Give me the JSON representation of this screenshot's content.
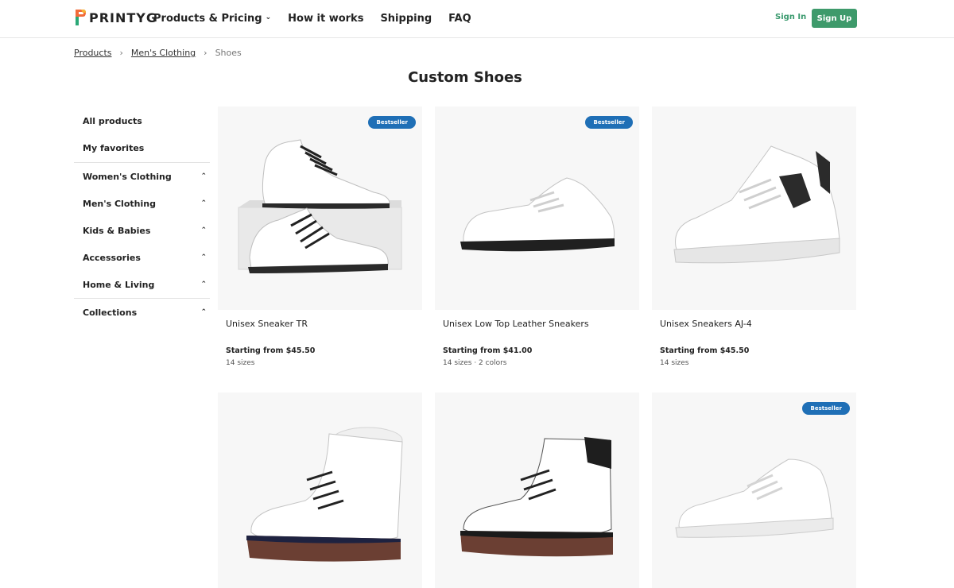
{
  "header": {
    "logo_text": "PRINTYG",
    "nav": [
      {
        "label": "Products & Pricing",
        "has_dropdown": true
      },
      {
        "label": "How it works"
      },
      {
        "label": "Shipping"
      },
      {
        "label": "FAQ"
      }
    ],
    "signin_label": "Sign In",
    "signup_label": "Sign Up"
  },
  "breadcrumb": {
    "items": [
      "Products",
      "Men's Clothing"
    ],
    "current": "Shoes"
  },
  "page_title": "Custom Shoes",
  "sidebar": {
    "links": [
      "All products",
      "My favorites"
    ],
    "categories": [
      "Women's Clothing",
      "Men's Clothing",
      "Kids & Babies",
      "Accessories",
      "Home & Living"
    ],
    "collections": "Collections"
  },
  "products": [
    {
      "name": "Unisex Sneaker TR",
      "price": "Starting from $45.50",
      "meta": "14 sizes",
      "badge": "Bestseller",
      "icon": "high-top-sneaker-with-box"
    },
    {
      "name": "Unisex Low Top Leather Sneakers",
      "price": "Starting from $41.00",
      "meta": "14 sizes · 2 colors",
      "badge": "Bestseller",
      "icon": "low-top-sneaker"
    },
    {
      "name": "Unisex Sneakers AJ-4",
      "price": "Starting from $45.50",
      "meta": "14 sizes",
      "badge": "",
      "icon": "aj4-sneaker"
    },
    {
      "name": "",
      "price": "",
      "meta": "",
      "badge": "",
      "icon": "fur-lined-boot"
    },
    {
      "name": "",
      "price": "",
      "meta": "",
      "badge": "",
      "icon": "leather-work-boot"
    },
    {
      "name": "",
      "price": "",
      "meta": "",
      "badge": "Bestseller",
      "icon": "af1-sneaker"
    }
  ],
  "colors": {
    "brand_green": "#3e9a6b",
    "badge_blue": "#1f6fb6",
    "image_bg": "#f7f7f7"
  }
}
